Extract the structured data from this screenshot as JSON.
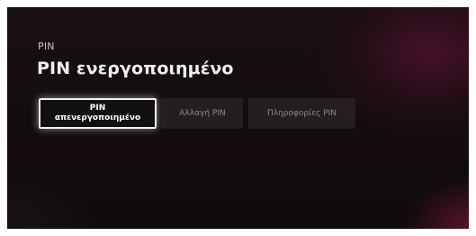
{
  "header": {
    "section": "PIN",
    "title": "PIN ενεργοποιημένο"
  },
  "buttons": [
    {
      "label_line1": "PIN",
      "label_line2": "απενεργοποιημένο",
      "state": "focused"
    },
    {
      "label": "Αλλαγή PIN"
    },
    {
      "label": "Πληροφορίες PIN"
    }
  ],
  "colors": {
    "background": "#140d10",
    "accent_glow": "#6e123c",
    "focused_border": "#f4f1f2"
  }
}
